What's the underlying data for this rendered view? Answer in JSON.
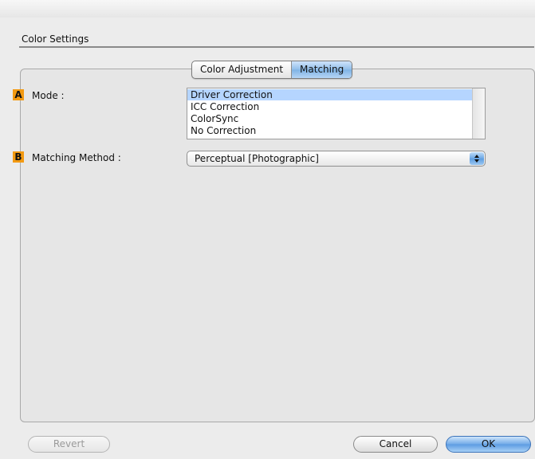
{
  "section": {
    "title": "Color Settings"
  },
  "tabs": [
    {
      "label": "Color Adjustment",
      "active": false
    },
    {
      "label": "Matching",
      "active": true
    }
  ],
  "mode": {
    "badge": "A",
    "label": "Mode :",
    "options": [
      "Driver Correction",
      "ICC Correction",
      "ColorSync",
      "No Correction"
    ],
    "selected": "Driver Correction"
  },
  "matching_method": {
    "badge": "B",
    "label": "Matching Method :",
    "value": "Perceptual [Photographic]"
  },
  "buttons": {
    "revert": "Revert",
    "cancel": "Cancel",
    "ok": "OK"
  },
  "colors": {
    "badge": "#f39a12",
    "selection": "#b5d5ff",
    "aqua_blue": "#6aa6e4"
  }
}
